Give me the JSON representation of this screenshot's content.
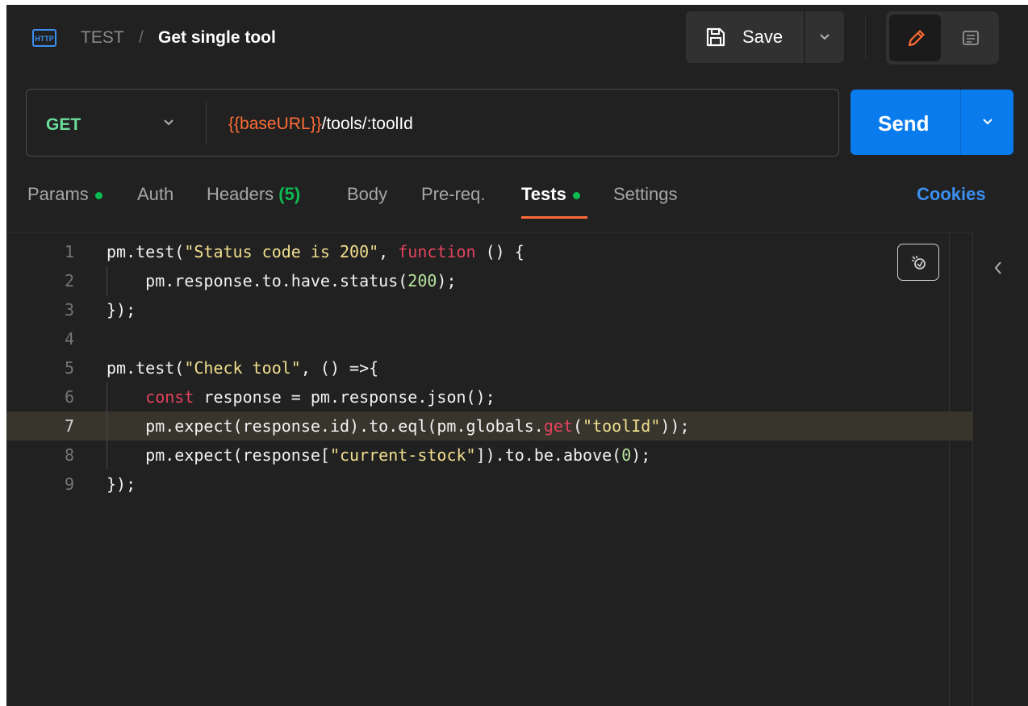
{
  "header": {
    "protocol_icon": "http-icon",
    "collection": "TEST",
    "separator": "/",
    "request_name": "Get single tool",
    "save_label": "Save",
    "save_icon": "floppy-icon",
    "mode_edit_icon": "pencil-icon",
    "mode_doc_icon": "comment-icon"
  },
  "request": {
    "method": "GET",
    "url_variable": "{{baseURL}}",
    "url_path": "/tools/:toolId",
    "send_label": "Send"
  },
  "tabs": {
    "params": "Params",
    "auth": "Auth",
    "headers": "Headers",
    "headers_count": "(5)",
    "body": "Body",
    "prereq": "Pre-req.",
    "tests": "Tests",
    "settings": "Settings",
    "active": "Tests",
    "cookies": "Cookies"
  },
  "editor": {
    "line_numbers": [
      "1",
      "2",
      "3",
      "4",
      "5",
      "6",
      "7",
      "8",
      "9"
    ],
    "highlighted_line": 7,
    "lines": [
      "pm.test(\"Status code is 200\", function () {",
      "    pm.response.to.have.status(200);",
      "});",
      "",
      "pm.test(\"Check tool\", () =>{",
      "    const response = pm.response.json();",
      "    pm.expect(response.id).to.eql(pm.globals.get(\"toolId\"));",
      "    pm.expect(response[\"current-stock\"]).to.be.above(0);",
      "});"
    ],
    "format_icon": "magic-wand-icon"
  },
  "colors": {
    "background": "#212121",
    "accent": "#ff6c37",
    "send": "#097bed",
    "method_get": "#6bdd9a",
    "status_dot": "#0cbb52",
    "link": "#3b8ff0"
  }
}
